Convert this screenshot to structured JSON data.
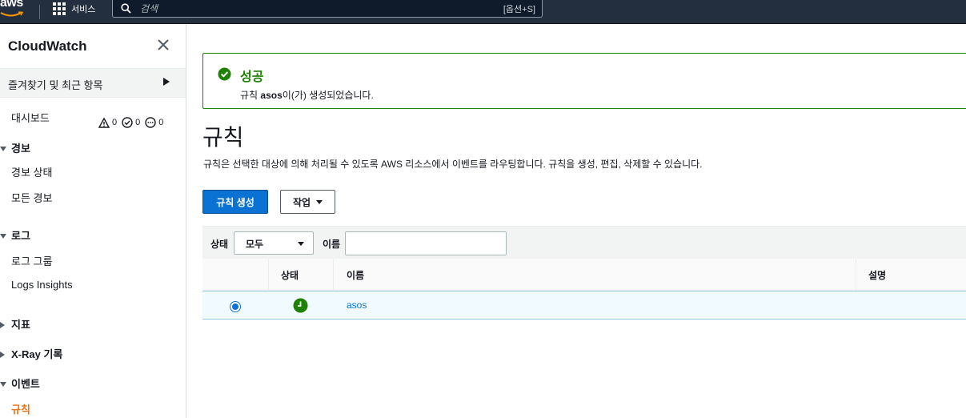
{
  "topbar": {
    "logo": "aws",
    "services_label": "서비스",
    "search_placeholder": "검색",
    "search_shortcut": "[옵션+S]"
  },
  "sidebar": {
    "title": "CloudWatch",
    "favorites_label": "즐겨찾기 및 최근 항목",
    "dashboard": "대시보드",
    "alarms_section": "경보",
    "alarm_counts": {
      "alarm": "0",
      "ok": "0",
      "insufficient": "0"
    },
    "alarm_items": [
      "경보 상태",
      "모든 경보"
    ],
    "logs_section": "로그",
    "logs_items": [
      "로그 그룹",
      "Logs Insights"
    ],
    "metrics_section": "지표",
    "xray_section": "X-Ray 기록",
    "events_section": "이벤트",
    "events_items": [
      "규칙"
    ]
  },
  "flash": {
    "title": "성공",
    "message_prefix": "규칙 ",
    "rule_name": "asos",
    "message_suffix": "이(가) 생성되었습니다."
  },
  "main": {
    "title": "규칙",
    "description": "규칙은 선택한 대상에 의해 처리될 수 있도록 AWS 리소스에서 이벤트를 라우팅합니다. 규칙을 생성, 편집, 삭제할 수 있습니다.",
    "create_button": "규칙 생성",
    "actions_button": "작업"
  },
  "filter": {
    "state_label": "상태",
    "state_value": "모두",
    "name_label": "이름",
    "name_value": ""
  },
  "table": {
    "columns": [
      "상태",
      "이름",
      "설명"
    ],
    "rows": [
      {
        "selected": true,
        "status": "enabled",
        "name": "asos",
        "description": ""
      }
    ]
  },
  "colors": {
    "topbar_bg": "#232f3e",
    "primary": "#0972d3",
    "success": "#1d8102",
    "active_nav": "#ec7211"
  }
}
